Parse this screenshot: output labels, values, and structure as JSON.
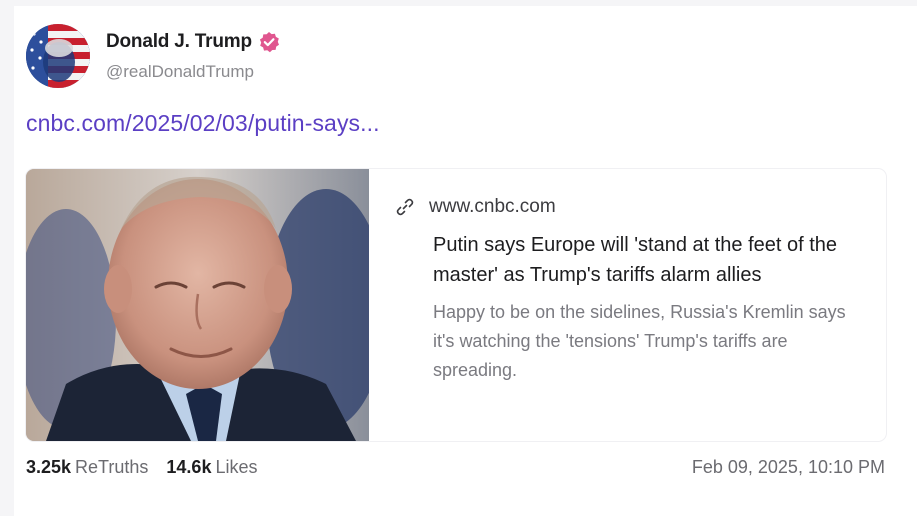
{
  "post": {
    "author": {
      "display_name": "Donald J. Trump",
      "handle": "@realDonaldTrump",
      "verified_icon": "verified-badge-icon",
      "verified_color": "#e0568f"
    },
    "link_text": "cnbc.com/2025/02/03/putin-says...",
    "link_color": "#5b3fc4",
    "card": {
      "icon": "link-icon",
      "domain": "www.cnbc.com",
      "title": "Putin says Europe will 'stand at the feet of the master' as Trump's tariffs alarm allies",
      "description": "Happy to be on the sidelines, Russia's Kremlin says it's watching the 'tensions' Trump's tariffs are spreading."
    },
    "stats": {
      "retruths_count": "3.25k",
      "retruths_label": "ReTruths",
      "likes_count": "14.6k",
      "likes_label": "Likes"
    },
    "timestamp": "Feb 09, 2025, 10:10 PM"
  }
}
